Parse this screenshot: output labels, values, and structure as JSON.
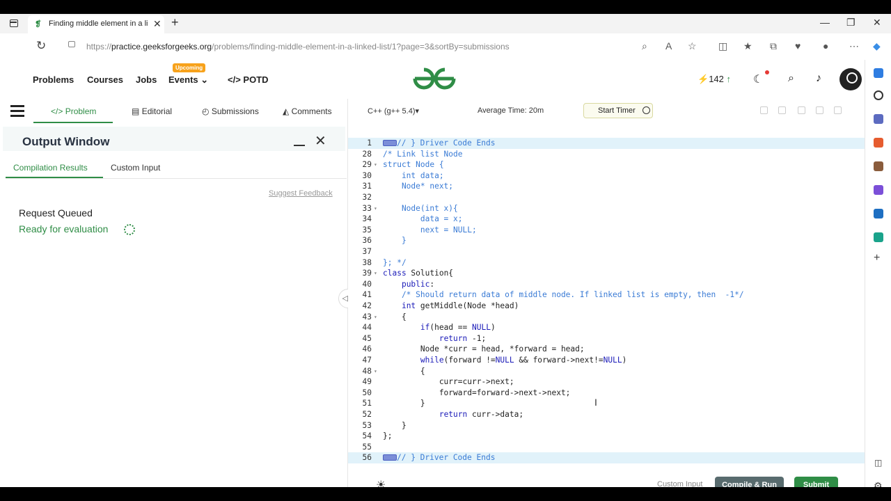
{
  "browser": {
    "tab_title": "Finding middle element in a link",
    "url_prefix": "https://",
    "url_host": "practice.geeksforgeeks.org",
    "url_path": "/problems/finding-middle-element-in-a-linked-list/1?page=3&sortBy=submissions"
  },
  "header": {
    "nav": [
      "Problems",
      "Courses",
      "Jobs",
      "Events",
      "POTD"
    ],
    "upcoming_badge": "Upcoming",
    "streak": "142",
    "colors": {
      "brand": "#2f8d46",
      "badge": "#f7a21b"
    }
  },
  "problem_tabs": [
    "Problem",
    "Editorial",
    "Submissions",
    "Comments"
  ],
  "output": {
    "title": "Output Window",
    "tabs": [
      "Compilation Results",
      "Custom Input"
    ],
    "suggest": "Suggest Feedback",
    "status": "Request Queued",
    "ready": "Ready for evaluation"
  },
  "editor": {
    "language": "C++ (g++ 5.4)",
    "avg_time": "Average Time: 20m",
    "timer": "Start Timer",
    "lines": [
      {
        "n": "1",
        "t": "// } Driver Code Ends",
        "hl": true,
        "fold": true
      },
      {
        "n": "28",
        "t": "/* Link list Node"
      },
      {
        "n": "29",
        "t": "struct Node {"
      },
      {
        "n": "30",
        "t": "    int data;"
      },
      {
        "n": "31",
        "t": "    Node* next;"
      },
      {
        "n": "32",
        "t": ""
      },
      {
        "n": "33",
        "t": "    Node(int x){"
      },
      {
        "n": "34",
        "t": "        data = x;"
      },
      {
        "n": "35",
        "t": "        next = NULL;"
      },
      {
        "n": "36",
        "t": "    }"
      },
      {
        "n": "37",
        "t": ""
      },
      {
        "n": "38",
        "t": "}; */"
      },
      {
        "n": "39",
        "t": "class Solution{"
      },
      {
        "n": "40",
        "t": "    public:"
      },
      {
        "n": "41",
        "t": "    /* Should return data of middle node. If linked list is empty, then  -1*/"
      },
      {
        "n": "42",
        "t": "    int getMiddle(Node *head)"
      },
      {
        "n": "43",
        "t": "    {"
      },
      {
        "n": "44",
        "t": "        if(head == NULL)"
      },
      {
        "n": "45",
        "t": "            return -1;"
      },
      {
        "n": "46",
        "t": "        Node *curr = head, *forward = head;"
      },
      {
        "n": "47",
        "t": "        while(forward !=NULL && forward->next!=NULL)"
      },
      {
        "n": "48",
        "t": "        {"
      },
      {
        "n": "49",
        "t": "            curr=curr->next;"
      },
      {
        "n": "50",
        "t": "            forward=forward->next->next;"
      },
      {
        "n": "51",
        "t": "        }"
      },
      {
        "n": "52",
        "t": "            return curr->data;"
      },
      {
        "n": "53",
        "t": "    }"
      },
      {
        "n": "54",
        "t": "};"
      },
      {
        "n": "55",
        "t": ""
      },
      {
        "n": "56",
        "t": "// } Driver Code Ends",
        "hl": true,
        "fold": true
      }
    ]
  },
  "footer": {
    "custom_input": "Custom Input",
    "compile": "Compile & Run",
    "submit": "Submit"
  }
}
